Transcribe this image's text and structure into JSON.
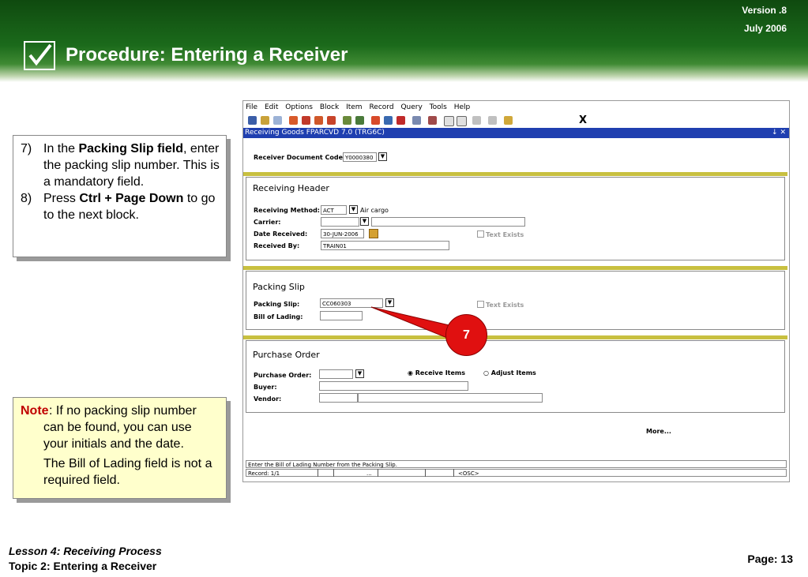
{
  "header": {
    "version": "Version .8",
    "date": "July  2006",
    "title": "Procedure: Entering a Receiver"
  },
  "steps": [
    {
      "num": "7)",
      "pre": "In the ",
      "bold": "Packing Slip field",
      "post": ", enter the packing slip number.  This is a mandatory field."
    },
    {
      "num": "8)",
      "pre": "Press ",
      "bold": "Ctrl + Page Down",
      "post": " to go to the next block."
    }
  ],
  "note": {
    "label": "Note",
    "text1": ": If no packing slip number can be found, you can use your initials and the date.",
    "text2": "The Bill of Lading field is not a required field."
  },
  "footer": {
    "lesson": "Lesson 4: Receiving Process",
    "topic": "Topic 2: Entering a Receiver",
    "page": "Page: 13"
  },
  "app": {
    "menu": [
      "File",
      "Edit",
      "Options",
      "Block",
      "Item",
      "Record",
      "Query",
      "Tools",
      "Help"
    ],
    "window_title": "Receiving Goods  FPARCVD  7.0  (TRG6C)",
    "exit_label": "X",
    "receiver_code_label": "Receiver Document Code",
    "receiver_code_value": "Y0000380",
    "header_section": {
      "title": "Receiving Header",
      "method_label": "Receiving Method:",
      "method_value": "ACT",
      "method_desc": "Air cargo",
      "carrier_label": "Carrier:",
      "date_label": "Date Received:",
      "date_value": "30-JUN-2006",
      "received_by_label": "Received By:",
      "received_by_value": "TRAIN01",
      "text_exists": "Text Exists"
    },
    "packing_section": {
      "title": "Packing Slip",
      "slip_label": "Packing Slip:",
      "slip_value": "CC060303",
      "lading_label": "Bill of Lading:",
      "text_exists": "Text Exists"
    },
    "po_section": {
      "title": "Purchase Order",
      "po_label": "Purchase Order:",
      "receive_items": "Receive Items",
      "adjust_items": "Adjust Items",
      "buyer_label": "Buyer:",
      "vendor_label": "Vendor:"
    },
    "more_label": "More...",
    "status_hint": "Enter the Bill of Lading Number from the Packing Slip.",
    "record": "Record: 1/1",
    "ellipsis": "...",
    "osc": "<OSC>"
  },
  "callout_number": "7",
  "colors": {
    "banner": "#1b6a1b",
    "note_label": "#c00000",
    "callout_bg": "#ffffcc",
    "badge": "#e01010"
  }
}
